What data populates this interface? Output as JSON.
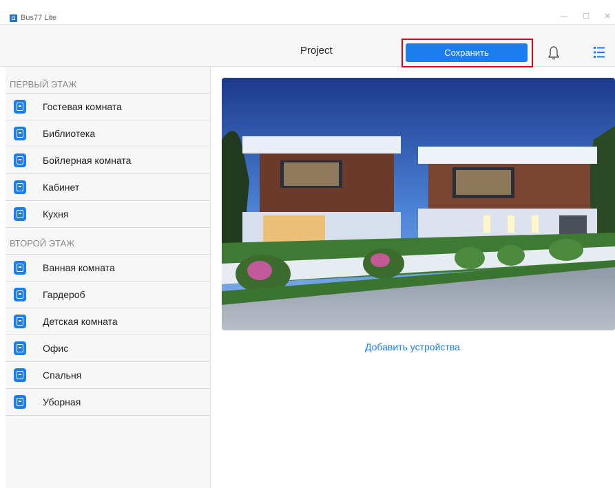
{
  "window": {
    "app_title": "Bus77 Lite",
    "minimize": "—",
    "maximize": "☐",
    "close": "✕"
  },
  "toolbar": {
    "title": "Project",
    "save_label": "Сохранить",
    "bell_icon": "bell-icon",
    "menu_icon": "list-icon"
  },
  "sidebar": {
    "sections": [
      {
        "header": "ПЕРВЫЙ ЭТАЖ",
        "items": [
          {
            "label": "Гостевая комната",
            "icon": "guest-room-icon"
          },
          {
            "label": "Библиотека",
            "icon": "library-icon"
          },
          {
            "label": "Бойлерная комната",
            "icon": "boiler-room-icon"
          },
          {
            "label": "Кабинет",
            "icon": "cabinet-icon"
          },
          {
            "label": "Кухня",
            "icon": "kitchen-icon"
          }
        ]
      },
      {
        "header": "ВТОРОЙ ЭТАЖ",
        "items": [
          {
            "label": "Ванная комната",
            "icon": "bathroom-icon"
          },
          {
            "label": "Гардероб",
            "icon": "wardrobe-icon"
          },
          {
            "label": "Детская комната",
            "icon": "kids-room-icon"
          },
          {
            "label": "Офис",
            "icon": "office-icon"
          },
          {
            "label": "Спальня",
            "icon": "bedroom-icon"
          },
          {
            "label": "Уборная",
            "icon": "restroom-icon"
          }
        ]
      }
    ]
  },
  "main": {
    "add_devices_label": "Добавить устройства"
  },
  "colors": {
    "accent": "#1a7ef0",
    "highlight": "#e0001b"
  }
}
